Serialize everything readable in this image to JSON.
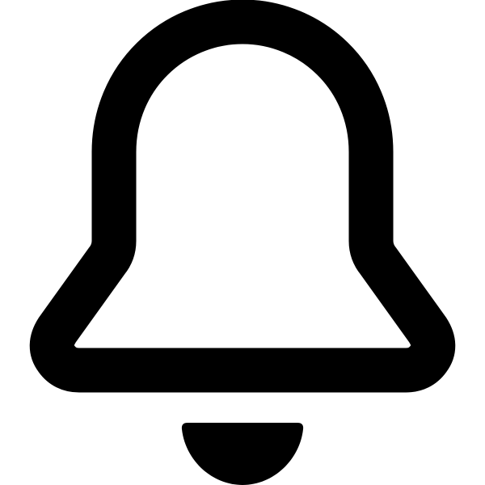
{
  "icon": {
    "name": "bell-icon",
    "style": "outline",
    "color": "#000000",
    "background": "#ffffff"
  }
}
